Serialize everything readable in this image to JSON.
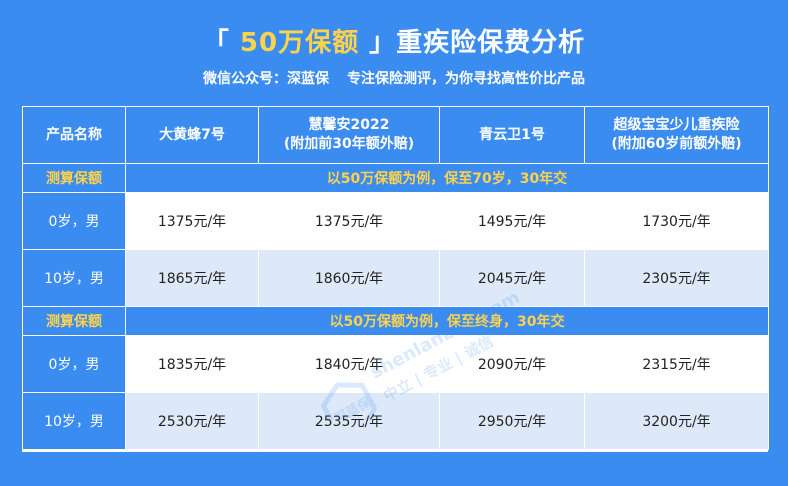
{
  "header": {
    "title_bracket_open": "「",
    "title_highlight": " 50万保额 ",
    "title_bracket_close": "」",
    "title_rest": "重疾险保费分析",
    "subtitle_left": "微信公众号：深蓝保",
    "subtitle_right": "专注保险测评，为你寻找高性价比产品"
  },
  "table": {
    "headers": [
      "产品名称",
      "大黄蜂7号",
      "慧馨安2022\n(附加前30年额外赔)",
      "青云卫1号",
      "超级宝宝少儿重疾险\n(附加60岁前额外赔)"
    ],
    "sections": [
      {
        "label": "测算保额",
        "condition": "以50万保额为例，保至70岁，30年交",
        "rows": [
          {
            "label": "0岁，男",
            "values": [
              "1375元/年",
              "1375元/年",
              "1495元/年",
              "1730元/年"
            ]
          },
          {
            "label": "10岁，男",
            "values": [
              "1865元/年",
              "1860元/年",
              "2045元/年",
              "2305元/年"
            ]
          }
        ]
      },
      {
        "label": "测算保额",
        "condition": "以50万保额为例，保至终身，30年交",
        "rows": [
          {
            "label": "0岁，男",
            "values": [
              "1835元/年",
              "1840元/年",
              "2090元/年",
              "2315元/年"
            ]
          },
          {
            "label": "10岁，男",
            "values": [
              "2530元/年",
              "2535元/年",
              "2950元/年",
              "3200元/年"
            ]
          }
        ]
      }
    ]
  },
  "watermark": {
    "site": "shenlanbao.com",
    "line2": "中立 | 专业 | 诚信",
    "logo": "深蓝保"
  },
  "colors": {
    "background": "#3b8cf0",
    "highlight": "#ffd24a",
    "alt_row": "#dde9f8"
  }
}
